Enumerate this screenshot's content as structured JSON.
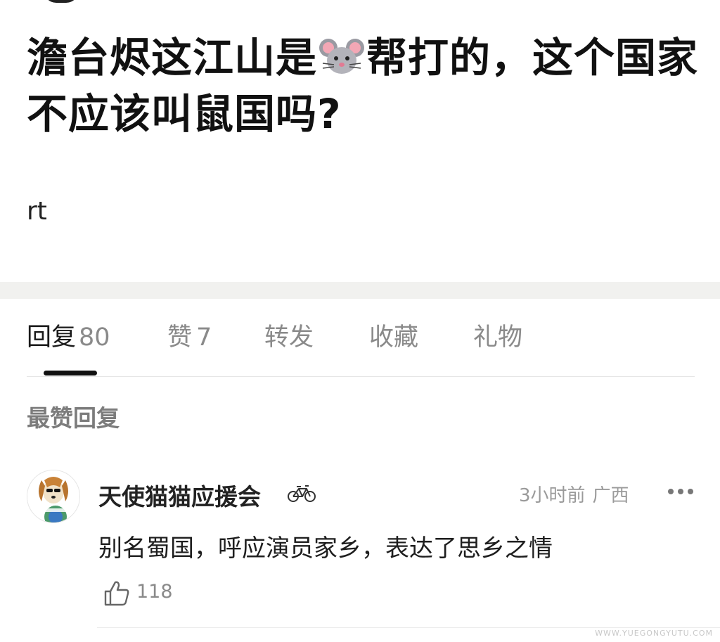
{
  "post": {
    "title_part1": "澹台烬这江山是",
    "title_emoji": "mouse-face-emoji",
    "title_part2": "帮打的，这个国家不应该叫鼠国吗?",
    "body": "rt"
  },
  "tabs": [
    {
      "label": "回复",
      "count": "80",
      "active": true
    },
    {
      "label": "赞",
      "count": "7",
      "active": false
    },
    {
      "label": "转发",
      "count": "",
      "active": false
    },
    {
      "label": "收藏",
      "count": "",
      "active": false
    },
    {
      "label": "礼物",
      "count": "",
      "active": false
    }
  ],
  "section": {
    "heading": "最赞回复"
  },
  "reply": {
    "username": "天使猫猫应援会",
    "badge_icon": "bicycle-icon",
    "time": "3小时前",
    "location": "广西",
    "text": "别名蜀国，呼应演员家乡，表达了思乡之情",
    "likes": "118"
  },
  "watermark": "WWW.YUEGONGYUTU.COM",
  "colors": {
    "text_primary": "#1a1a1a",
    "text_secondary": "#8a8a8a",
    "divider_band": "#f1f1ef",
    "tab_indicator": "#111111"
  }
}
